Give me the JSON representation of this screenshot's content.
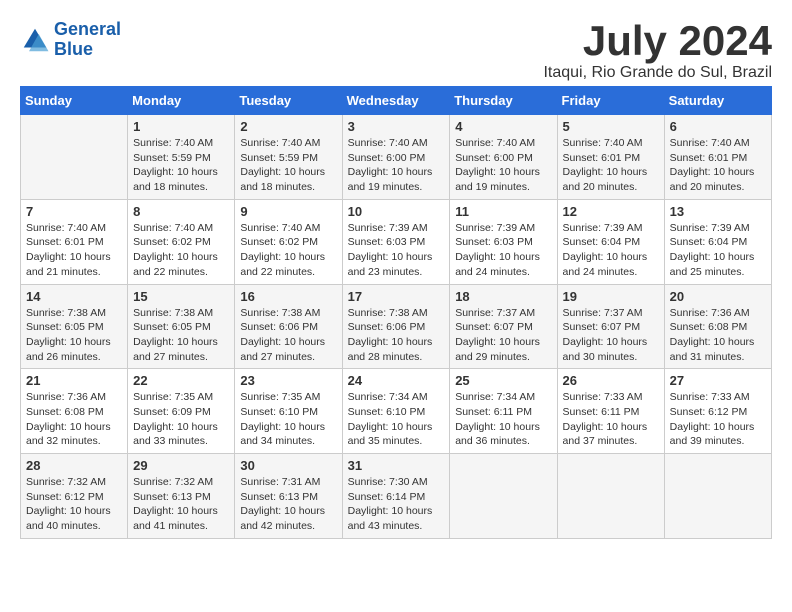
{
  "logo": {
    "line1": "General",
    "line2": "Blue"
  },
  "title": "July 2024",
  "location": "Itaqui, Rio Grande do Sul, Brazil",
  "headers": [
    "Sunday",
    "Monday",
    "Tuesday",
    "Wednesday",
    "Thursday",
    "Friday",
    "Saturday"
  ],
  "weeks": [
    [
      {
        "day": "",
        "info": ""
      },
      {
        "day": "1",
        "info": "Sunrise: 7:40 AM\nSunset: 5:59 PM\nDaylight: 10 hours\nand 18 minutes."
      },
      {
        "day": "2",
        "info": "Sunrise: 7:40 AM\nSunset: 5:59 PM\nDaylight: 10 hours\nand 18 minutes."
      },
      {
        "day": "3",
        "info": "Sunrise: 7:40 AM\nSunset: 6:00 PM\nDaylight: 10 hours\nand 19 minutes."
      },
      {
        "day": "4",
        "info": "Sunrise: 7:40 AM\nSunset: 6:00 PM\nDaylight: 10 hours\nand 19 minutes."
      },
      {
        "day": "5",
        "info": "Sunrise: 7:40 AM\nSunset: 6:01 PM\nDaylight: 10 hours\nand 20 minutes."
      },
      {
        "day": "6",
        "info": "Sunrise: 7:40 AM\nSunset: 6:01 PM\nDaylight: 10 hours\nand 20 minutes."
      }
    ],
    [
      {
        "day": "7",
        "info": "Sunrise: 7:40 AM\nSunset: 6:01 PM\nDaylight: 10 hours\nand 21 minutes."
      },
      {
        "day": "8",
        "info": "Sunrise: 7:40 AM\nSunset: 6:02 PM\nDaylight: 10 hours\nand 22 minutes."
      },
      {
        "day": "9",
        "info": "Sunrise: 7:40 AM\nSunset: 6:02 PM\nDaylight: 10 hours\nand 22 minutes."
      },
      {
        "day": "10",
        "info": "Sunrise: 7:39 AM\nSunset: 6:03 PM\nDaylight: 10 hours\nand 23 minutes."
      },
      {
        "day": "11",
        "info": "Sunrise: 7:39 AM\nSunset: 6:03 PM\nDaylight: 10 hours\nand 24 minutes."
      },
      {
        "day": "12",
        "info": "Sunrise: 7:39 AM\nSunset: 6:04 PM\nDaylight: 10 hours\nand 24 minutes."
      },
      {
        "day": "13",
        "info": "Sunrise: 7:39 AM\nSunset: 6:04 PM\nDaylight: 10 hours\nand 25 minutes."
      }
    ],
    [
      {
        "day": "14",
        "info": "Sunrise: 7:38 AM\nSunset: 6:05 PM\nDaylight: 10 hours\nand 26 minutes."
      },
      {
        "day": "15",
        "info": "Sunrise: 7:38 AM\nSunset: 6:05 PM\nDaylight: 10 hours\nand 27 minutes."
      },
      {
        "day": "16",
        "info": "Sunrise: 7:38 AM\nSunset: 6:06 PM\nDaylight: 10 hours\nand 27 minutes."
      },
      {
        "day": "17",
        "info": "Sunrise: 7:38 AM\nSunset: 6:06 PM\nDaylight: 10 hours\nand 28 minutes."
      },
      {
        "day": "18",
        "info": "Sunrise: 7:37 AM\nSunset: 6:07 PM\nDaylight: 10 hours\nand 29 minutes."
      },
      {
        "day": "19",
        "info": "Sunrise: 7:37 AM\nSunset: 6:07 PM\nDaylight: 10 hours\nand 30 minutes."
      },
      {
        "day": "20",
        "info": "Sunrise: 7:36 AM\nSunset: 6:08 PM\nDaylight: 10 hours\nand 31 minutes."
      }
    ],
    [
      {
        "day": "21",
        "info": "Sunrise: 7:36 AM\nSunset: 6:08 PM\nDaylight: 10 hours\nand 32 minutes."
      },
      {
        "day": "22",
        "info": "Sunrise: 7:35 AM\nSunset: 6:09 PM\nDaylight: 10 hours\nand 33 minutes."
      },
      {
        "day": "23",
        "info": "Sunrise: 7:35 AM\nSunset: 6:10 PM\nDaylight: 10 hours\nand 34 minutes."
      },
      {
        "day": "24",
        "info": "Sunrise: 7:34 AM\nSunset: 6:10 PM\nDaylight: 10 hours\nand 35 minutes."
      },
      {
        "day": "25",
        "info": "Sunrise: 7:34 AM\nSunset: 6:11 PM\nDaylight: 10 hours\nand 36 minutes."
      },
      {
        "day": "26",
        "info": "Sunrise: 7:33 AM\nSunset: 6:11 PM\nDaylight: 10 hours\nand 37 minutes."
      },
      {
        "day": "27",
        "info": "Sunrise: 7:33 AM\nSunset: 6:12 PM\nDaylight: 10 hours\nand 39 minutes."
      }
    ],
    [
      {
        "day": "28",
        "info": "Sunrise: 7:32 AM\nSunset: 6:12 PM\nDaylight: 10 hours\nand 40 minutes."
      },
      {
        "day": "29",
        "info": "Sunrise: 7:32 AM\nSunset: 6:13 PM\nDaylight: 10 hours\nand 41 minutes."
      },
      {
        "day": "30",
        "info": "Sunrise: 7:31 AM\nSunset: 6:13 PM\nDaylight: 10 hours\nand 42 minutes."
      },
      {
        "day": "31",
        "info": "Sunrise: 7:30 AM\nSunset: 6:14 PM\nDaylight: 10 hours\nand 43 minutes."
      },
      {
        "day": "",
        "info": ""
      },
      {
        "day": "",
        "info": ""
      },
      {
        "day": "",
        "info": ""
      }
    ]
  ]
}
